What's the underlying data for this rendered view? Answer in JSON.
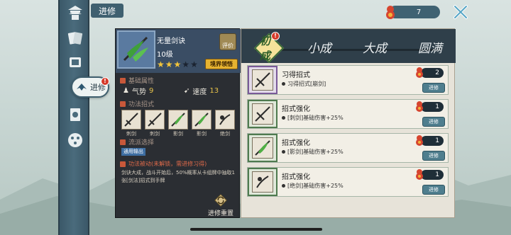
{
  "topbar": {
    "title": "进修",
    "currency_amount": "7"
  },
  "sidebar": {
    "items": [
      {
        "icon": "pagoda-icon"
      },
      {
        "icon": "cards-icon"
      },
      {
        "icon": "scroll-icon"
      },
      {
        "icon": "advance-icon",
        "label": "进修",
        "active": true,
        "badge": "!"
      },
      {
        "icon": "book-icon"
      },
      {
        "icon": "dice-icon"
      }
    ]
  },
  "skill": {
    "name": "无量剑诀",
    "level": "10级",
    "stars_filled": 3,
    "stars_total": 5,
    "eval_label": "评价",
    "realm_button": "境界领悟",
    "basic_attr_title": "基础属性",
    "qi_label": "气势",
    "qi_value": "9",
    "speed_label": "速度",
    "speed_value": "13",
    "moves_title": "功法招式",
    "moves": [
      {
        "label": "刺剑"
      },
      {
        "label": "刺剑"
      },
      {
        "label": "影剑"
      },
      {
        "label": "影剑"
      },
      {
        "label": "绝剑"
      }
    ],
    "school_title": "流派选择",
    "school_chip": "通用输出",
    "passive_title": "功法被动(未解锁，需进修习得)",
    "passive_desc": "剑诀大成，战斗开始后，50%概率从卡组牌中抽取1张[剑法]招式到手牌",
    "reset_label": "进修重置"
  },
  "tabs": [
    {
      "label": "初成",
      "active": true,
      "badge": "!"
    },
    {
      "label": "小成",
      "active": false
    },
    {
      "label": "大成",
      "active": false
    },
    {
      "label": "圆满",
      "active": false
    }
  ],
  "cards": [
    {
      "title": "习得招式",
      "desc": "习得招式[崩剑]",
      "cost": "2",
      "button": "进修",
      "frame": "purple"
    },
    {
      "title": "招式强化",
      "desc": "[刺剑]基础伤害+25%",
      "cost": "1",
      "button": "进修",
      "frame": "green"
    },
    {
      "title": "招式强化",
      "desc": "[影剑]基础伤害+25%",
      "cost": "1",
      "button": "进修",
      "frame": "green"
    },
    {
      "title": "招式强化",
      "desc": "[绝剑]基础伤害+25%",
      "cost": "1",
      "button": "进修",
      "frame": "green"
    }
  ],
  "colors": {
    "accent_gold": "#e7b330",
    "sidebar_blue": "#4a6b7c",
    "badge_red": "#d53a2a",
    "tab_active": "#f6e39a"
  }
}
